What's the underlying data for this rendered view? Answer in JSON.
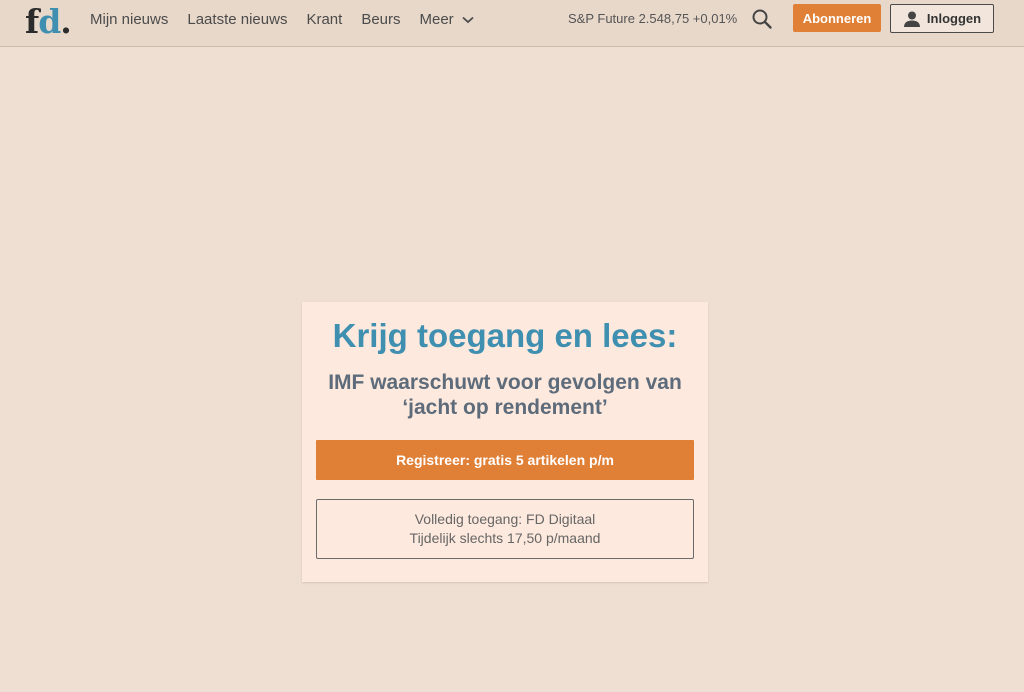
{
  "header": {
    "logo": {
      "f": "f",
      "d": "d",
      "dot": "."
    },
    "nav": [
      {
        "label": "Mijn nieuws"
      },
      {
        "label": "Laatste nieuws"
      },
      {
        "label": "Krant"
      },
      {
        "label": "Beurs"
      },
      {
        "label": "Meer"
      }
    ],
    "ticker": "S&P Future 2.548,75 +0,01%",
    "subscribe_label": "Abonneren",
    "login_label": "Inloggen"
  },
  "paywall": {
    "title": "Krijg toegang en lees:",
    "article_title": "IMF waarschuwt voor gevolgen van ‘jacht op rendement’",
    "register_label": "Registreer: gratis 5 artikelen p/m",
    "digital_line1": "Volledig toegang: FD Digitaal",
    "digital_line2": "Tijdelijk slechts 17,50 p/maand"
  },
  "icons": {
    "search": "search-icon",
    "user": "user-icon",
    "more": "chevron-down-icon"
  },
  "colors": {
    "accent_orange": "#e07f36",
    "brand_blue": "#3f8fb0",
    "page_bg": "#efdfd3",
    "header_bg": "#e8d8ca",
    "card_bg": "#fde9dd"
  }
}
